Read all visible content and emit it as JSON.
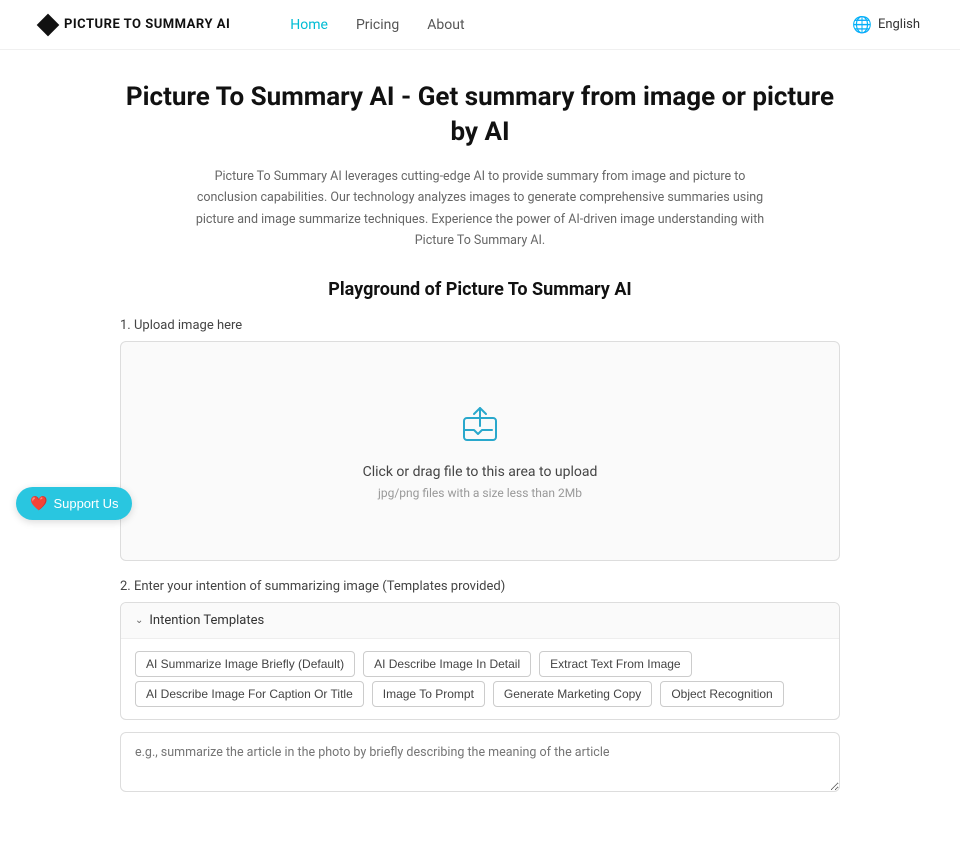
{
  "nav": {
    "logo_text": "PICTURE TO SUMMARY AI",
    "links": [
      {
        "label": "Home",
        "active": true
      },
      {
        "label": "Pricing",
        "active": false
      },
      {
        "label": "About",
        "active": false
      }
    ],
    "language": "English"
  },
  "hero": {
    "title": "Picture To Summary AI - Get summary from image or picture by AI",
    "description": "Picture To Summary AI leverages cutting-edge AI to provide summary from image and picture to conclusion capabilities. Our technology analyzes images to generate comprehensive summaries using picture and image summarize techniques. Experience the power of AI-driven image understanding with Picture To Summary AI."
  },
  "playground": {
    "title": "Playground of Picture To Summary AI",
    "upload_label": "1. Upload image here",
    "upload_text": "Click or drag file to this area to upload",
    "upload_hint": "jpg/png files with a size less than 2Mb",
    "intention_label": "2. Enter your intention of summarizing image (Templates provided)",
    "intention_header": "Intention Templates",
    "templates": [
      "AI Summarize Image Briefly (Default)",
      "AI Describe Image In Detail",
      "Extract Text From Image",
      "AI Describe Image For Caption Or Title",
      "Image To Prompt",
      "Generate Marketing Copy",
      "Object Recognition"
    ],
    "textarea_placeholder": "e.g., summarize the article in the photo by briefly describing the meaning of the article"
  },
  "support": {
    "label": "Support Us"
  }
}
